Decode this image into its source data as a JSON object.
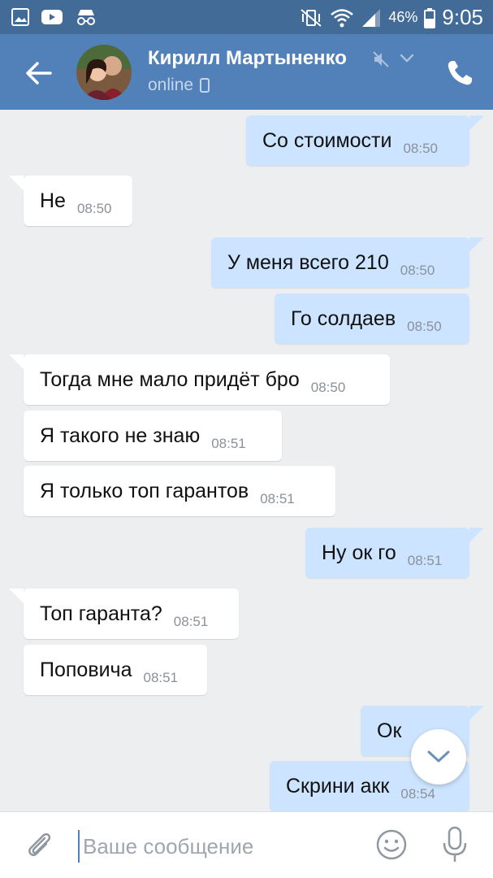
{
  "status_bar": {
    "battery": "46%",
    "time": "9:05"
  },
  "header": {
    "contact_name": "Кирилл Мартыненко",
    "status": "online"
  },
  "messages": [
    {
      "dir": "out",
      "text": "Со стоимости",
      "time": "08:50"
    },
    {
      "dir": "in",
      "text": "Не",
      "time": "08:50"
    },
    {
      "dir": "out",
      "text": "У меня всего 210",
      "time": "08:50"
    },
    {
      "dir": "out",
      "text": "Го солдаев",
      "time": "08:50"
    },
    {
      "dir": "in",
      "text": "Тогда мне мало придёт бро",
      "time": "08:50"
    },
    {
      "dir": "in",
      "text": "Я такого не знаю",
      "time": "08:51"
    },
    {
      "dir": "in",
      "text": "Я только топ гарантов",
      "time": "08:51"
    },
    {
      "dir": "out",
      "text": "Ну ок го",
      "time": "08:51"
    },
    {
      "dir": "in",
      "text": "Топ гаранта?",
      "time": "08:51"
    },
    {
      "dir": "in",
      "text": "Поповича",
      "time": "08:51"
    },
    {
      "dir": "out",
      "text": "Ок",
      "time": ""
    },
    {
      "dir": "out",
      "text": "Скрини акк",
      "time": "08:54"
    }
  ],
  "input": {
    "placeholder": "Ваше сообщение"
  },
  "icons": {
    "back": "arrow-left-icon",
    "mute": "muted-speaker-icon",
    "call": "phone-icon",
    "attach": "paperclip-icon",
    "emoji": "smiley-icon",
    "mic": "microphone-icon",
    "scroll_down": "chevron-down-icon"
  },
  "colors": {
    "header": "#5181b8",
    "status_bar": "#436b98",
    "incoming_bubble": "#ffffff",
    "outgoing_bubble": "#cce4ff",
    "background": "#edeef0"
  }
}
